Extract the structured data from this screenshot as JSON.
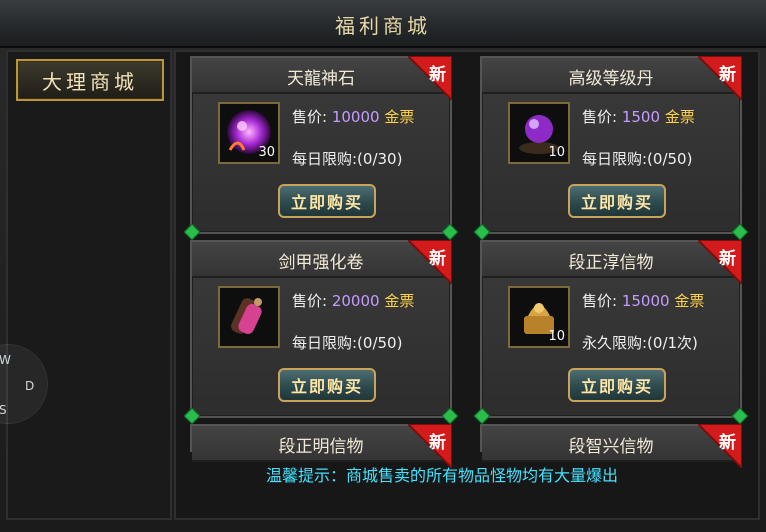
{
  "window": {
    "title": "福利商城"
  },
  "sidebar": {
    "tab_label": "大理商城"
  },
  "shop": {
    "items": [
      {
        "name": "天龍神石",
        "badge": "新",
        "price_label": "售价:",
        "price_value": "10000",
        "price_unit": "金票",
        "limit_text": "每日限购:(0/30)",
        "count": "30",
        "buy_label": "立即购买",
        "icon": "purple-orb-icon"
      },
      {
        "name": "高级等级丹",
        "badge": "新",
        "price_label": "售价:",
        "price_value": "1500",
        "price_unit": "金票",
        "limit_text": "每日限购:(0/50)",
        "count": "10",
        "buy_label": "立即购买",
        "icon": "purple-pill-icon"
      },
      {
        "name": "剑甲强化卷",
        "badge": "新",
        "price_label": "售价:",
        "price_value": "20000",
        "price_unit": "金票",
        "limit_text": "每日限购:(0/50)",
        "count": "",
        "buy_label": "立即购买",
        "icon": "scroll-icon"
      },
      {
        "name": "段正淳信物",
        "badge": "新",
        "price_label": "售价:",
        "price_value": "15000",
        "price_unit": "金票",
        "limit_text": "永久限购:(0/1次)",
        "count": "10",
        "buy_label": "立即购买",
        "icon": "golden-seal-icon"
      },
      {
        "name": "段正明信物",
        "badge": "新"
      },
      {
        "name": "段智兴信物",
        "badge": "新"
      }
    ]
  },
  "tip": "温馨提示：商城售卖的所有物品怪物均有大量爆出",
  "overlay": {
    "letters": [
      "W",
      "D",
      "S"
    ]
  },
  "colors": {
    "accent_gold": "#d6b46a",
    "price_purple": "#c69bff",
    "currency_gold": "#ffd24a",
    "tip_cyan": "#43e2ff",
    "badge_red": "#d41b1b"
  }
}
